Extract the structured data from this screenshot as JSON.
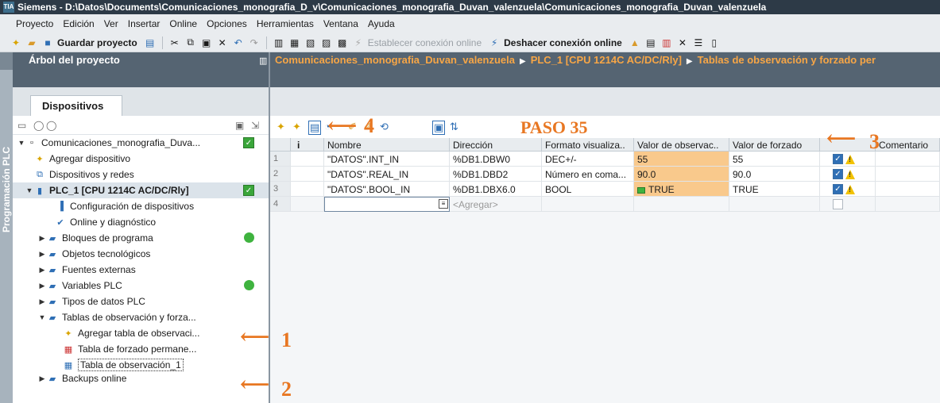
{
  "window": {
    "title": "Siemens  -  D:\\Datos\\Documents\\Comunicaciones_monografia_D_v\\Comunicaciones_monografia_Duvan_valenzuela\\Comunicaciones_monografia_Duvan_valenzuela",
    "app_icon": "TIA"
  },
  "menu": [
    "Proyecto",
    "Edición",
    "Ver",
    "Insertar",
    "Online",
    "Opciones",
    "Herramientas",
    "Ventana",
    "Ayuda"
  ],
  "toolbar": {
    "save_label": "Guardar proyecto",
    "connect_online_label": "Establecer conexión online",
    "disconnect_online_label": "Deshacer conexión online"
  },
  "side_tab": {
    "label": "Programación PLC"
  },
  "project_tree": {
    "title": "Árbol del proyecto",
    "tab": "Dispositivos",
    "items": [
      {
        "label": "Comunicaciones_monografia_Duva...",
        "icon": "project-icon",
        "status": "check"
      },
      {
        "label": "Agregar dispositivo",
        "icon": "add-device-icon"
      },
      {
        "label": "Dispositivos y redes",
        "icon": "network-icon"
      },
      {
        "label": "PLC_1 [CPU 1214C AC/DC/Rly]",
        "icon": "plc-icon",
        "status": "check"
      },
      {
        "label": "Configuración de dispositivos",
        "icon": "device-config-icon"
      },
      {
        "label": "Online y diagnóstico",
        "icon": "diagnostics-icon"
      },
      {
        "label": "Bloques de programa",
        "icon": "folder-icon",
        "status": "dot"
      },
      {
        "label": "Objetos tecnológicos",
        "icon": "folder-icon"
      },
      {
        "label": "Fuentes externas",
        "icon": "folder-icon"
      },
      {
        "label": "Variables PLC",
        "icon": "folder-icon",
        "status": "dot"
      },
      {
        "label": "Tipos de datos PLC",
        "icon": "folder-icon"
      },
      {
        "label": "Tablas de observación y forza...",
        "icon": "folder-icon"
      },
      {
        "label": "Agregar tabla de observaci...",
        "icon": "add-table-icon"
      },
      {
        "label": "Tabla de forzado permane...",
        "icon": "force-table-icon"
      },
      {
        "label": "Tabla de observación_1",
        "icon": "watch-table-icon"
      },
      {
        "label": "Backups online",
        "icon": "folder-icon"
      }
    ]
  },
  "breadcrumb": [
    "Comunicaciones_monografia_Duvan_valenzuela",
    "PLC_1 [CPU 1214C AC/DC/Rly]",
    "Tablas de observación y forzado per"
  ],
  "annotation": {
    "step_title": "PASO 35",
    "n1": "1",
    "n2": "2",
    "n3": "3",
    "n4": "4"
  },
  "table": {
    "headers": [
      "i",
      "Nombre",
      "Dirección",
      "Formato visualiza..",
      "Valor de observac..",
      "Valor de forzado",
      "",
      "Comentario"
    ],
    "rows": [
      {
        "no": "1",
        "name": "\"DATOS\".INT_IN",
        "address": "%DB1.DBW0",
        "format": "DEC+/-",
        "monitor": "55",
        "force": "55"
      },
      {
        "no": "2",
        "name": "\"DATOS\".REAL_IN",
        "address": "%DB1.DBD2",
        "format": "Número en coma...",
        "monitor": "90.0",
        "force": "90.0"
      },
      {
        "no": "3",
        "name": "\"DATOS\".BOOL_IN",
        "address": "%DB1.DBX6.0",
        "format": "BOOL",
        "monitor": "TRUE",
        "force": "TRUE"
      }
    ],
    "new_row_no": "4",
    "add_placeholder": "<Agregar>"
  },
  "colors": {
    "accent": "#e87722",
    "header": "#556472",
    "breadcrumb": "#f7a646"
  }
}
